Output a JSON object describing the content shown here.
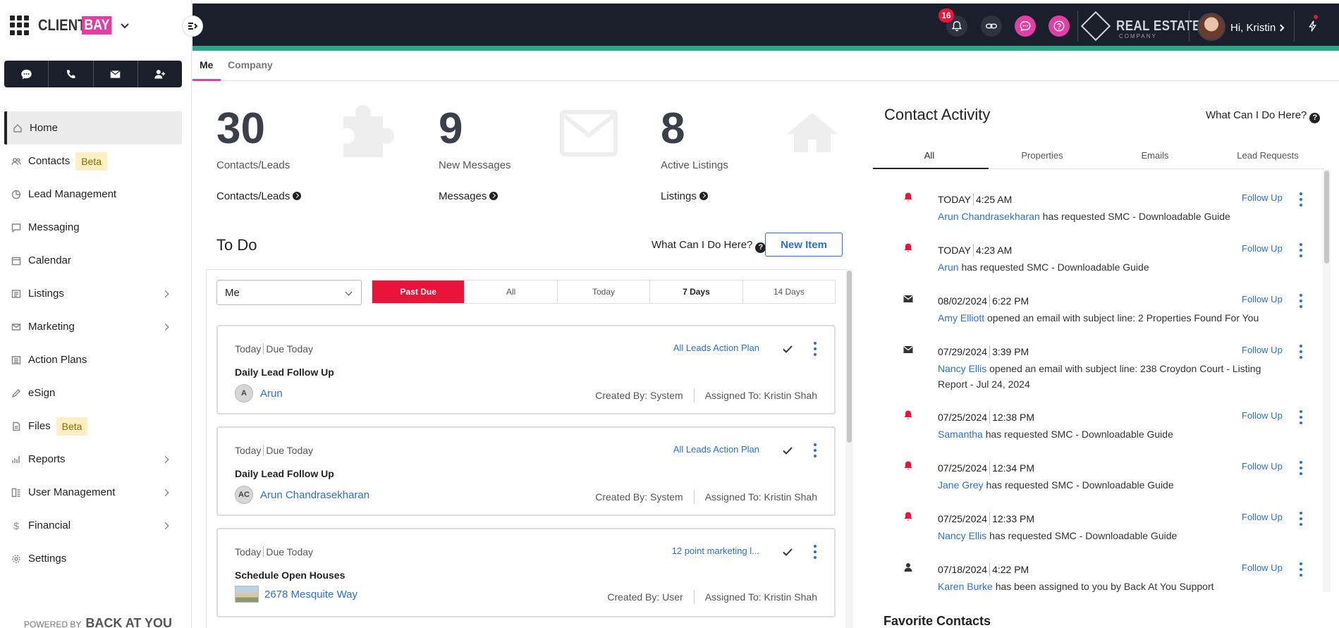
{
  "brand": {
    "client": "CLIENT",
    "bay": "BAY"
  },
  "powered_by": {
    "prefix": "POWERED BY",
    "name": "BACK AT YOU"
  },
  "sidebar": {
    "items": [
      {
        "label": "Home",
        "icon": "home-icon"
      },
      {
        "label": "Contacts",
        "icon": "contacts-icon",
        "badge": "Beta"
      },
      {
        "label": "Lead Management",
        "icon": "pie-chart-icon"
      },
      {
        "label": "Messaging",
        "icon": "message-icon"
      },
      {
        "label": "Calendar",
        "icon": "calendar-icon"
      },
      {
        "label": "Listings",
        "icon": "list-icon"
      },
      {
        "label": "Marketing",
        "icon": "mail-icon"
      },
      {
        "label": "Action Plans",
        "icon": "action-plan-icon"
      },
      {
        "label": "eSign",
        "icon": "pen-icon"
      },
      {
        "label": "Files",
        "icon": "file-icon",
        "badge": "Beta"
      },
      {
        "label": "Reports",
        "icon": "bar-chart-icon"
      },
      {
        "label": "User Management",
        "icon": "user-management-icon"
      },
      {
        "label": "Financial",
        "icon": "dollar-icon"
      },
      {
        "label": "Settings",
        "icon": "gear-icon"
      }
    ]
  },
  "topbar": {
    "notification_count": "16",
    "brokerage": {
      "name": "REAL ESTATE",
      "sub": "COMPANY"
    },
    "greeting": "Hi, Kristin"
  },
  "tabs": {
    "me": "Me",
    "company": "Company"
  },
  "stats": [
    {
      "value": "30",
      "label": "Contacts/Leads",
      "link": "Contacts/Leads"
    },
    {
      "value": "9",
      "label": "New Messages",
      "link": "Messages"
    },
    {
      "value": "8",
      "label": "Active Listings",
      "link": "Listings"
    }
  ],
  "todo": {
    "title": "To Do",
    "help": "What Can I Do Here?",
    "new_item": "New Item",
    "who": "Me",
    "filters": [
      "Past Due",
      "All",
      "Today",
      "7 Days",
      "14 Days"
    ],
    "tasks": [
      {
        "day": "Today",
        "due": "Due Today",
        "plan": "All Leads Action Plan",
        "title": "Daily Lead Follow Up",
        "initials": "A",
        "person": "Arun",
        "created": "Created By: System",
        "assigned": "Assigned To: Kristin Shah"
      },
      {
        "day": "Today",
        "due": "Due Today",
        "plan": "All Leads Action Plan",
        "title": "Daily Lead Follow Up",
        "initials": "AC",
        "person": "Arun Chandrasekharan",
        "created": "Created By: System",
        "assigned": "Assigned To: Kristin Shah"
      },
      {
        "day": "Today",
        "due": "Due Today",
        "plan": "12 point marketing l...",
        "title": "Schedule Open Houses",
        "initials": "",
        "person": "2678 Mesquite Way",
        "created": "Created By: User",
        "assigned": "Assigned To: Kristin Shah"
      }
    ]
  },
  "contact_activity": {
    "title": "Contact Activity",
    "help": "What Can I Do Here?",
    "tabs": [
      "All",
      "Properties",
      "Emails",
      "Lead Requests"
    ],
    "follow_label": "Follow Up",
    "items": [
      {
        "icon": "bell-icon",
        "date": "TODAY",
        "time": "4:25 AM",
        "name": "Arun Chandrasekharan",
        "text": " has requested SMC - Downloadable Guide"
      },
      {
        "icon": "bell-icon",
        "date": "TODAY",
        "time": "4:23 AM",
        "name": "Arun",
        "text": " has requested SMC - Downloadable Guide"
      },
      {
        "icon": "envelope-icon",
        "date": "08/02/2024",
        "time": "6:22 PM",
        "name": "Amy Elliott",
        "text": " opened an email with subject line: 2 Properties Found For You"
      },
      {
        "icon": "envelope-icon",
        "date": "07/29/2024",
        "time": "3:39 PM",
        "name": "Nancy Ellis",
        "text": " opened an email with subject line: 238 Croydon Court - Listing Report - Jul 24, 2024"
      },
      {
        "icon": "bell-icon",
        "date": "07/25/2024",
        "time": "12:38 PM",
        "name": "Samantha",
        "text": " has requested SMC - Downloadable Guide"
      },
      {
        "icon": "bell-icon",
        "date": "07/25/2024",
        "time": "12:34 PM",
        "name": "Jane Grey",
        "text": " has requested SMC - Downloadable Guide"
      },
      {
        "icon": "bell-icon",
        "date": "07/25/2024",
        "time": "12:33 PM",
        "name": "Nancy Ellis",
        "text": " has requested SMC - Downloadable Guide"
      },
      {
        "icon": "person-icon",
        "date": "07/18/2024",
        "time": "4:22 PM",
        "name": "Karen Burke",
        "text": " has been assigned to you by Back At You Support"
      }
    ]
  },
  "favorite_contacts": {
    "title": "Favorite Contacts"
  },
  "colors": {
    "accent": "#e03fa5",
    "alert": "#e8143a",
    "link": "#2a6fdb",
    "topbar": "#1a1f2b",
    "teal": "#2aa78b"
  }
}
